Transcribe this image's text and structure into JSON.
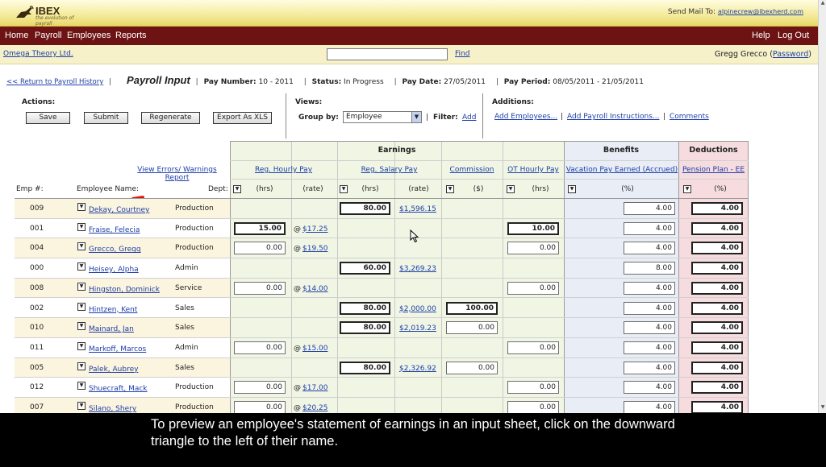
{
  "header": {
    "logo_brand": "IBEX",
    "logo_tagline": "the evolution of payroll",
    "send_mail_label": "Send Mail To:",
    "send_mail_address": "alpinecrew@ibexherd.com"
  },
  "nav": {
    "home": "Home",
    "payroll": "Payroll",
    "employees": "Employees",
    "reports": "Reports",
    "help": "Help",
    "logout": "Log Out"
  },
  "companybar": {
    "company": "Omega Theory Ltd.",
    "search_value": "",
    "find": "Find",
    "user_name": "Gregg Grecco (",
    "password_link": "Password",
    "user_close": ")"
  },
  "titlebar": {
    "back": "<< Return to Payroll History",
    "title": "Payroll Input",
    "pay_number_label": "Pay Number:",
    "pay_number": "10 - 2011",
    "status_label": "Status:",
    "status": "In Progress",
    "pay_date_label": "Pay Date:",
    "pay_date": "27/05/2011",
    "pay_period_label": "Pay Period:",
    "pay_period": "08/05/2011 - 21/05/2011"
  },
  "actions": {
    "label": "Actions:",
    "save": "Save",
    "submit": "Submit",
    "regenerate": "Regenerate",
    "export": "Export As XLS"
  },
  "views": {
    "label": "Views:",
    "group_by_label": "Group by:",
    "group_by_value": "Employee",
    "filter_label": "Filter:",
    "filter_add": "Add"
  },
  "additions": {
    "label": "Additions:",
    "add_employees": "Add Employees...",
    "add_payroll_instructions": "Add Payroll Instructions...",
    "comments": "Comments"
  },
  "grid": {
    "groups": {
      "earnings": "Earnings",
      "benefits": "Benefits",
      "deductions": "Deductions"
    },
    "view_errors": "View Errors/ Warnings Report",
    "columns": {
      "reg_hourly": "Reg. Hourly Pay",
      "reg_salary": "Reg. Salary Pay",
      "commission": "Commission",
      "ot_hourly": "OT Hourly Pay",
      "vacation": "Vacation Pay Earned (Accrued)",
      "pension": "Pension Plan - EE"
    },
    "subheaders": {
      "emp_num": "Emp #:",
      "emp_name": "Employee Name:",
      "dept": "Dept:",
      "hrs": "(hrs)",
      "rate": "(rate)",
      "dollar": "($)",
      "pct": "(%)"
    },
    "rows": [
      {
        "num": "009",
        "name": "Dekay, Courtney",
        "dept": "Production",
        "rh_hrs": "",
        "rh_rate": "",
        "rs_hrs": "80.00",
        "rs_rate": "$1,596.15",
        "comm": "",
        "ot": "",
        "vac": "4.00",
        "pen": "4.00"
      },
      {
        "num": "001",
        "name": "Fraise, Felecia",
        "dept": "Production",
        "rh_hrs": "15.00",
        "rh_rate": "$17.25",
        "rs_hrs": "",
        "rs_rate": "",
        "comm": "",
        "ot": "10.00",
        "vac": "4.00",
        "pen": "4.00"
      },
      {
        "num": "004",
        "name": "Grecco, Gregg",
        "dept": "Production",
        "rh_hrs": "0.00",
        "rh_rate": "$19.50",
        "rs_hrs": "",
        "rs_rate": "",
        "comm": "",
        "ot": "0.00",
        "vac": "4.00",
        "pen": "4.00"
      },
      {
        "num": "000",
        "name": "Heisey, Alpha",
        "dept": "Admin",
        "rh_hrs": "",
        "rh_rate": "",
        "rs_hrs": "60.00",
        "rs_rate": "$3,269.23",
        "comm": "",
        "ot": "",
        "vac": "8.00",
        "pen": "4.00"
      },
      {
        "num": "008",
        "name": "Hingston, Dominick",
        "dept": "Service",
        "rh_hrs": "0.00",
        "rh_rate": "$14.00",
        "rs_hrs": "",
        "rs_rate": "",
        "comm": "",
        "ot": "0.00",
        "vac": "4.00",
        "pen": "4.00"
      },
      {
        "num": "002",
        "name": "Hintzen, Kent",
        "dept": "Sales",
        "rh_hrs": "",
        "rh_rate": "",
        "rs_hrs": "80.00",
        "rs_rate": "$2,000.00",
        "comm": "100.00",
        "ot": "",
        "vac": "4.00",
        "pen": "4.00"
      },
      {
        "num": "010",
        "name": "Mainard, Jan",
        "dept": "Sales",
        "rh_hrs": "",
        "rh_rate": "",
        "rs_hrs": "80.00",
        "rs_rate": "$2,019.23",
        "comm": "0.00",
        "ot": "",
        "vac": "4.00",
        "pen": "4.00"
      },
      {
        "num": "011",
        "name": "Markoff, Marcos",
        "dept": "Admin",
        "rh_hrs": "0.00",
        "rh_rate": "$15.00",
        "rs_hrs": "",
        "rs_rate": "",
        "comm": "",
        "ot": "0.00",
        "vac": "4.00",
        "pen": "4.00"
      },
      {
        "num": "005",
        "name": "Palek, Aubrey",
        "dept": "Sales",
        "rh_hrs": "",
        "rh_rate": "",
        "rs_hrs": "80.00",
        "rs_rate": "$2,326.92",
        "comm": "0.00",
        "ot": "",
        "vac": "4.00",
        "pen": "4.00"
      },
      {
        "num": "012",
        "name": "Shuecraft, Mack",
        "dept": "Production",
        "rh_hrs": "0.00",
        "rh_rate": "$17.00",
        "rs_hrs": "",
        "rs_rate": "",
        "comm": "",
        "ot": "0.00",
        "vac": "4.00",
        "pen": "4.00"
      },
      {
        "num": "007",
        "name": "Silano, Shery",
        "dept": "Production",
        "rh_hrs": "0.00",
        "rh_rate": "$20.25",
        "rs_hrs": "",
        "rs_rate": "",
        "comm": "",
        "ot": "0.00",
        "vac": "4.00",
        "pen": "4.00"
      }
    ]
  },
  "caption": {
    "text": "To preview an employee's statement of earnings in an input sheet, click on the downward triangle to the left of their name."
  },
  "colors": {
    "nav_bg": "#6e1313",
    "header_bg": "#f4ea9a",
    "earnings_bg": "#f1f6e4",
    "benefits_bg": "#e9edf5",
    "deductions_bg": "#f6dcdf",
    "link": "#1d3ea8"
  }
}
